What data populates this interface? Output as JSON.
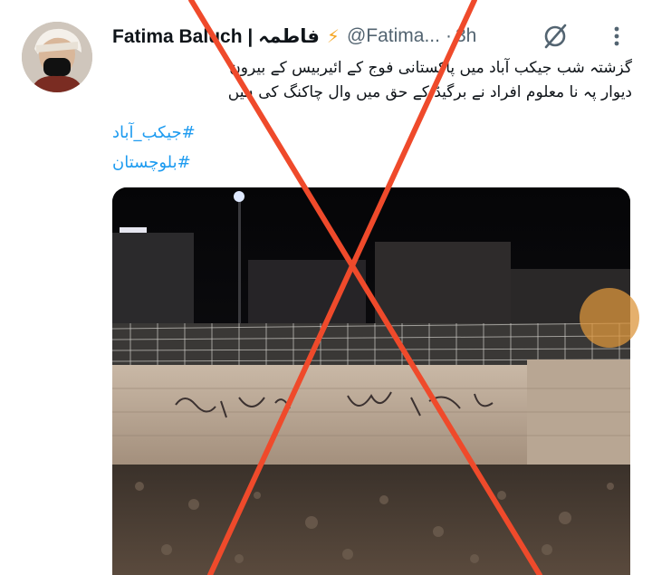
{
  "post": {
    "author_name": "Fatima Baluch | فاطمہ",
    "handle": "@Fatima...",
    "separator": "·",
    "time": "3h",
    "text_line_1": "گزشتہ شب جیکب آباد میں پاکستانی فوج کے ائیربیس کے بیرون",
    "text_line_2": "دیوار پہ نا معلوم افراد نے برگیڈ کے حق میں وال چاکنگ کی ہیں",
    "hashtags": [
      "#جیکب_آباد",
      "#بلوچستان"
    ]
  },
  "icons": {
    "verified": "lightning-bolt-icon",
    "grok": "grok-icon",
    "more": "more-vertical-icon"
  },
  "colors": {
    "link": "#1d9bf0",
    "cross_mark": "#ef4a2b",
    "secondary_text": "#536471"
  }
}
